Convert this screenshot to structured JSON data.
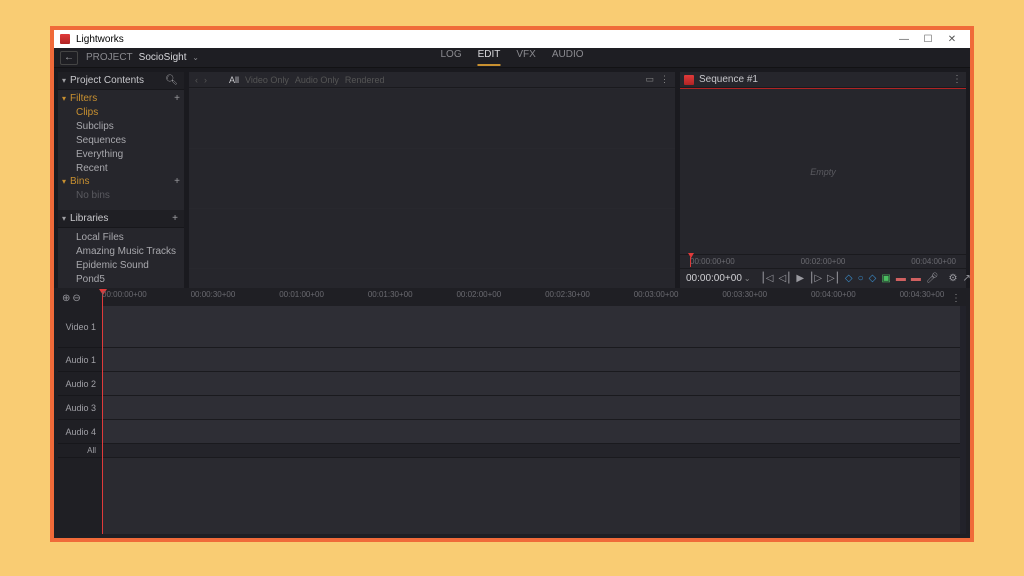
{
  "window": {
    "title": "Lightworks"
  },
  "toolbar": {
    "project_label": "PROJECT",
    "project_name": "SocioSight",
    "tabs": {
      "log": "LOG",
      "edit": "EDIT",
      "vfx": "VFX",
      "audio": "AUDIO"
    }
  },
  "sidebar": {
    "contents_title": "Project Contents",
    "filters_label": "Filters",
    "items": [
      "Clips",
      "Subclips",
      "Sequences",
      "Everything",
      "Recent"
    ],
    "bins_label": "Bins",
    "no_bins": "No bins",
    "libraries_title": "Libraries",
    "libraries": [
      "Local Files",
      "Amazing Music Tracks",
      "Epidemic Sound",
      "Pond5"
    ]
  },
  "content_filters": {
    "all": "All",
    "video_only": "Video Only",
    "audio_only": "Audio Only",
    "rendered": "Rendered"
  },
  "sequence": {
    "title": "Sequence #1",
    "empty": "Empty",
    "ruler": [
      "00:00:00+00",
      "00:02:00+00",
      "00:04:00+00"
    ],
    "timecode": "00:00:00+00"
  },
  "timeline": {
    "ruler": [
      "00:00:00+00",
      "00:00:30+00",
      "00:01:00+00",
      "00:01:30+00",
      "00:02:00+00",
      "00:02:30+00",
      "00:03:00+00",
      "00:03:30+00",
      "00:04:00+00",
      "00:04:30+00"
    ],
    "tracks": [
      "Video 1",
      "Audio 1",
      "Audio 2",
      "Audio 3",
      "Audio 4",
      "All"
    ]
  }
}
